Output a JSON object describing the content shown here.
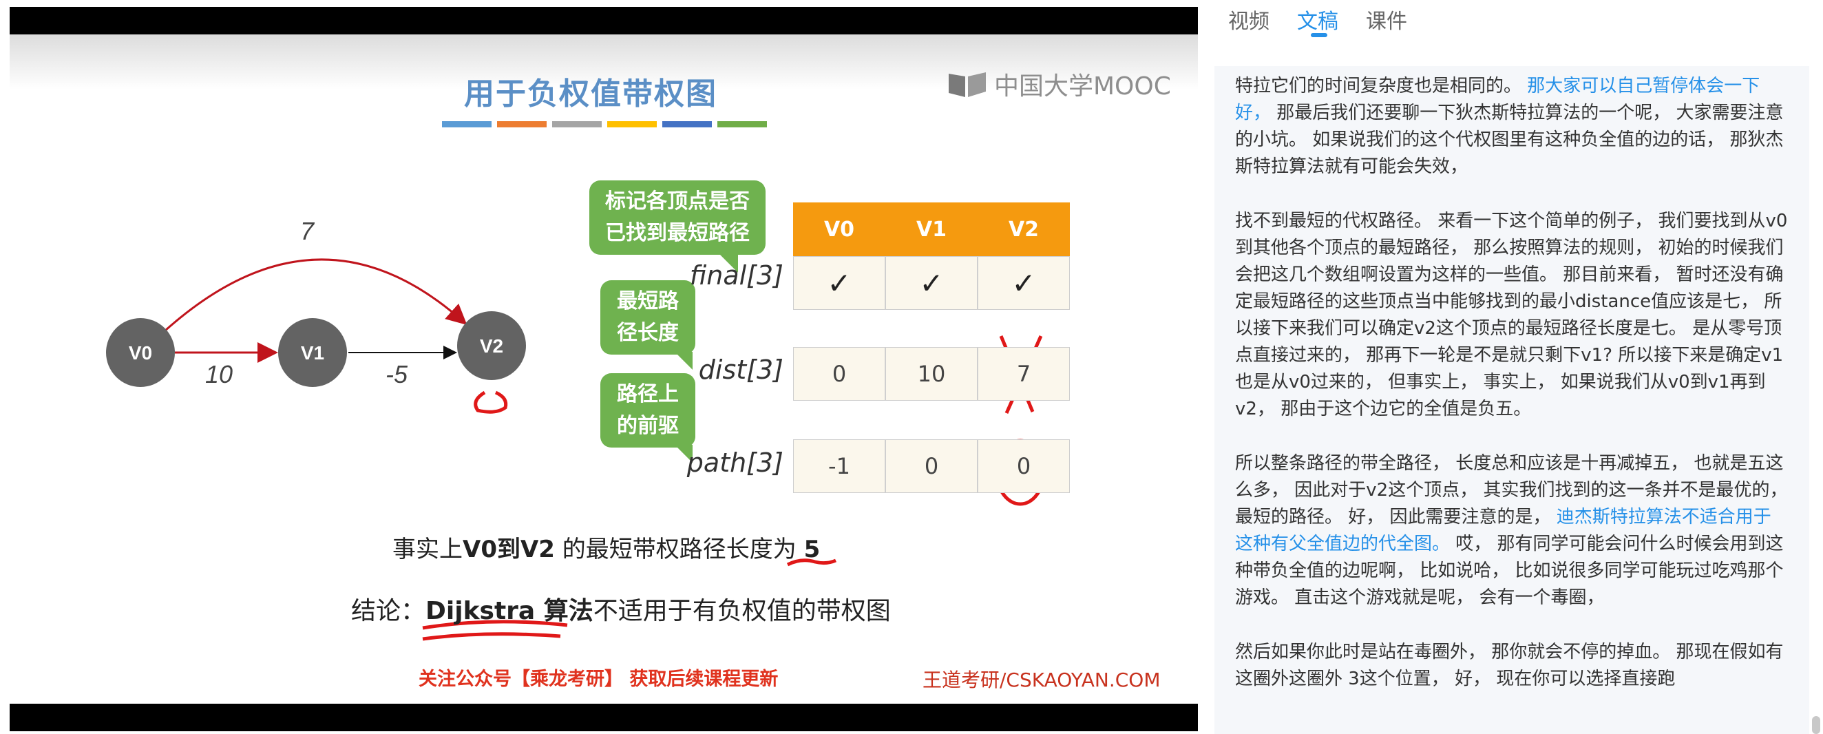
{
  "slide": {
    "title": "用于负权值带权图",
    "logo": "中国大学MOOC",
    "strip_colors": [
      "#5a9bd5",
      "#ed7d31",
      "#a5a5a5",
      "#ffc000",
      "#4472c4",
      "#70ad47"
    ],
    "graph": {
      "nodes": [
        "V0",
        "V1",
        "V2"
      ],
      "edge_weights": {
        "v0_v2": "7",
        "v0_v1": "10",
        "v1_v2": "-5"
      }
    },
    "bubbles": {
      "final": "标记各顶点是否已找到最短路径",
      "dist": "最短路径长度",
      "path": "路径上的前驱"
    },
    "table": {
      "headers": [
        "V0",
        "V1",
        "V2"
      ],
      "rows": [
        {
          "label": "final[3]",
          "cells": [
            "✓",
            "✓",
            "✓"
          ]
        },
        {
          "label": "dist[3]",
          "cells": [
            "0",
            "10",
            "7"
          ]
        },
        {
          "label": "path[3]",
          "cells": [
            "-1",
            "0",
            "0"
          ]
        }
      ]
    },
    "fact": {
      "prefix": "事实上",
      "bold1": "V0",
      "mid1": "到",
      "bold2": "V2",
      "mid2": " 的最短带权路径长度为 ",
      "value": "5"
    },
    "conclusion": {
      "prefix": "结论：",
      "strong": "Dijkstra 算法",
      "rest": "不适用于有负权值的带权图"
    },
    "follow_note": "关注公众号【乘龙考研】 获取后续课程更新",
    "watermark": "王道考研/CSKAOYAN.COM",
    "colors": {
      "node": "#636363",
      "arrow_red": "#c0141c",
      "header": "#f59a0f",
      "bubble": "#6fb24f",
      "annot_red": "#e01818"
    }
  },
  "panel": {
    "tabs": [
      {
        "label": "视频"
      },
      {
        "label": "文稿"
      },
      {
        "label": "课件"
      }
    ],
    "active_tab": "文稿",
    "paragraphs": [
      {
        "a": "特拉它们的时间复杂度也是相同的。 ",
        "hl": "那大家可以自己暂停体会一下好，",
        "b": " 那最后我们还要聊一下狄杰斯特拉算法的一个呢， 大家需要注意的小坑。 如果说我们的这个代权图里有这种负全值的边的话， 那狄杰斯特拉算法就有可能会失效，"
      },
      {
        "a": "找不到最短的代权路径。 来看一下这个简单的例子， 我们要找到从v0到其他各个顶点的最短路径， 那么按照算法的规则， 初始的时候我们会把这几个数组啊设置为这样的一些值。 那目前来看， 暂时还没有确定最短路径的这些顶点当中能够找到的最小distance值应该是七， 所以接下来我们可以确定v2这个顶点的最短路径长度是七。 是从零号顶点直接过来的， 那再下一轮是不是就只剩下v1? 所以接下来是确定v1也是从v0过来的， 但事实上， 事实上， 如果说我们从v0到v1再到v2， 那由于这个边它的全值是负五。",
        "hl": "",
        "b": ""
      },
      {
        "a": "所以整条路径的带全路径， 长度总和应该是十再减掉五， 也就是五这么多， 因此对于v2这个顶点， 其实我们找到的这一条并不是最优的， 最短的路径。 好， 因此需要注意的是， ",
        "hl": "迪杰斯特拉算法不适合用于这种有父全值边的代全图。",
        "b": " 哎， 那有同学可能会问什么时候会用到这种带负全值的边呢啊， 比如说哈， 比如说很多同学可能玩过吃鸡那个游戏。 直击这个游戏就是呢， 会有一个毒圈，"
      },
      {
        "a": "然后如果你此时是站在毒圈外， 那你就会不停的掉血。 那现在假如有这圈外这圈外 3这个位置， 好， 现在你可以选择直接跑",
        "hl": "",
        "b": ""
      }
    ]
  }
}
